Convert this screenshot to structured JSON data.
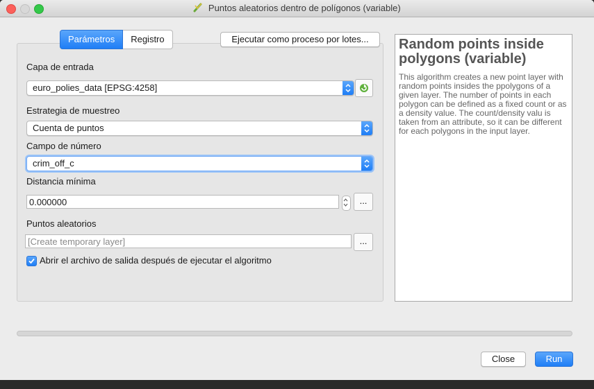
{
  "window": {
    "title": "Puntos aleatorios dentro de polígonos (variable)",
    "title_icon": "qgis-processing-icon"
  },
  "tabs": [
    {
      "label": "Parámetros",
      "active": true
    },
    {
      "label": "Registro",
      "active": false
    }
  ],
  "batch_button": "Ejecutar como proceso por lotes...",
  "params": {
    "input_layer": {
      "label": "Capa de entrada",
      "value": "euro_polies_data [EPSG:4258]"
    },
    "sampling_strategy": {
      "label": "Estrategia de muestreo",
      "value": "Cuenta de puntos"
    },
    "number_field": {
      "label": "Campo de número",
      "value": "crim_off_c"
    },
    "min_distance": {
      "label": "Distancia mínima",
      "value": "0.000000",
      "button": "..."
    },
    "random_points": {
      "label": "Puntos aleatorios",
      "placeholder": "[Create temporary layer]",
      "button": "..."
    },
    "open_output": {
      "label": "Abrir el archivo de salida después de ejecutar el algoritmo",
      "checked": true
    }
  },
  "help": {
    "title": "Random points inside polygons (variable)",
    "body": "This algorithm creates a new point layer with random points insides the ppolygons of a given layer. The number of points in each polygon can be defined as a fixed count or as a density value. The count/density valu is taken from an attribute, so it can be different for each polygons in the input layer."
  },
  "progress": {
    "value": 0
  },
  "buttons": {
    "close": "Close",
    "run": "Run"
  },
  "colors": {
    "accent": "#1f7ef6",
    "close": "#fc605b",
    "minimize": "#d8d8d8",
    "maximize": "#34c84a"
  }
}
